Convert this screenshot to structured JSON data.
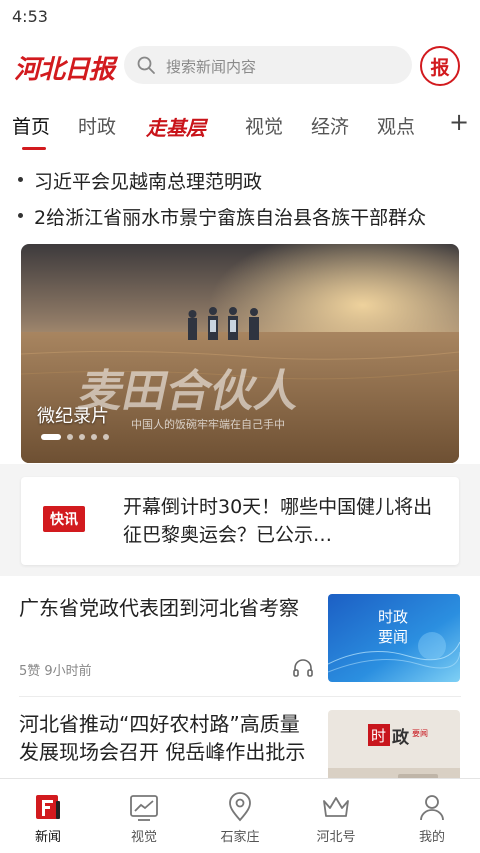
{
  "status_bar": {
    "time": "4:53"
  },
  "header": {
    "logo_text": "河北日报",
    "search_placeholder": "搜索新闻内容",
    "paper_badge": "报"
  },
  "tabs": [
    {
      "label": "首页",
      "active": true
    },
    {
      "label": "时政",
      "active": false
    },
    {
      "label": "走基层",
      "active": false,
      "special": true
    },
    {
      "label": "视觉",
      "active": false
    },
    {
      "label": "经济",
      "active": false
    },
    {
      "label": "观点",
      "active": false
    }
  ],
  "tab_add": "+",
  "ticker": [
    {
      "text": "习近平会见越南总理范明政"
    },
    {
      "text": "2给浙江省丽水市景宁畲族自治县各族干部群众"
    }
  ],
  "hero": {
    "label": "微纪录片",
    "overlay_title": "麦田合伙人",
    "overlay_subtitle": "中国人的饭碗牢牢端在自己手中",
    "dots_total": 5,
    "active_dot": 0
  },
  "flash": {
    "badge": "快讯",
    "text": "开幕倒计时30天！哪些中国健儿将出征巴黎奥运会？已公示…"
  },
  "news": [
    {
      "title": "广东省党政代表团到河北省考察",
      "meta": "5赞  9小时前",
      "has_audio": true,
      "thumb_text": [
        "时政",
        "要闻"
      ]
    },
    {
      "title": "河北省推动“四好农村路”高质量发展现场会召开 倪岳峰作出批示",
      "meta": "",
      "has_audio": false,
      "thumb_text": [
        "时",
        "政",
        "要闻"
      ]
    }
  ],
  "bottom_nav": [
    {
      "label": "新闻",
      "icon": "news-icon",
      "active": true
    },
    {
      "label": "视觉",
      "icon": "chart-frame-icon",
      "active": false
    },
    {
      "label": "石家庄",
      "icon": "location-pin-icon",
      "active": false
    },
    {
      "label": "河北号",
      "icon": "crown-icon",
      "active": false
    },
    {
      "label": "我的",
      "icon": "user-icon",
      "active": false
    }
  ],
  "colors": {
    "brand_red": "#d21a1e",
    "text_primary": "#222222",
    "text_secondary": "#888888",
    "section_bg": "#f4f4f4"
  }
}
